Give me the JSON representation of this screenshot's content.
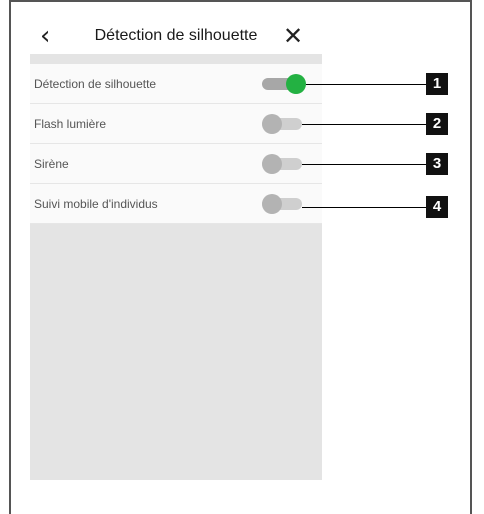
{
  "header": {
    "back_glyph": "‹",
    "title": "Détection de silhouette",
    "close_glyph": "✕"
  },
  "settings": [
    {
      "label": "Détection de silhouette",
      "state": "on",
      "badge": "1"
    },
    {
      "label": "Flash lumière",
      "state": "off",
      "badge": "2"
    },
    {
      "label": "Sirène",
      "state": "off",
      "badge": "3"
    },
    {
      "label": "Suivi mobile d'individus",
      "state": "off",
      "badge": "4"
    }
  ],
  "colors": {
    "toggle_on": "#23b142",
    "toggle_off": "#b3b3b3",
    "panel_bg": "#e4e4e4",
    "badge_bg": "#111111"
  },
  "icons": {
    "back": "chevron-left-icon",
    "close": "close-icon"
  }
}
